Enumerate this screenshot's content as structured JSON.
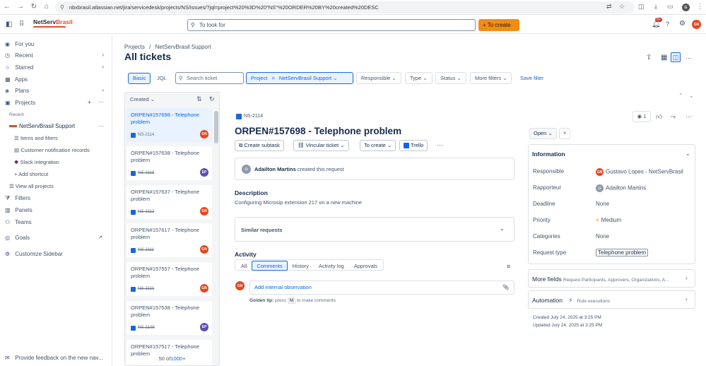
{
  "browser": {
    "url": "nbxbrasil.atlassian.net/jira/servicedesk/projects/NS/issues/?jql=project%20%3D%20\"NS\"%20ORDER%20BY%20created%20DESC",
    "profile_initial": "G"
  },
  "topnav": {
    "logo_a": "NetServ",
    "logo_b": "Brasil",
    "search_placeholder": "To look for",
    "create_label": "To create",
    "notif_badge": "9+",
    "user_initials": "GN"
  },
  "sidebar": {
    "items": [
      {
        "label": "For you",
        "icon": "user-circle-icon"
      },
      {
        "label": "Recent",
        "icon": "clock-icon"
      },
      {
        "label": "Starred",
        "icon": "star-icon"
      },
      {
        "label": "Apps",
        "icon": "apps-icon"
      },
      {
        "label": "Plans",
        "icon": "plans-icon"
      },
      {
        "label": "Projects",
        "icon": "folder-icon"
      }
    ],
    "recent_heading": "Recent",
    "project_name": "NetServBrasil Support",
    "sub_items": [
      "Items and filters",
      "Customer notification records",
      "Slack integration",
      "Add shortcut"
    ],
    "view_all": "View all projects",
    "lower_items": [
      "Filters",
      "Panels",
      "Teams"
    ],
    "goals": "Goals",
    "customize": "Customize Sidebar",
    "feedback": "Provide feedback on the new nav..."
  },
  "main": {
    "breadcrumb_projects": "Projects",
    "breadcrumb_sep": "/",
    "breadcrumb_project": "NetServBrasil Support",
    "title": "All tickets",
    "basic": "Basic",
    "jql": "JQL",
    "search_ticket": "Search ticket",
    "filter_project_label": "Project",
    "filter_project_op": "=",
    "filter_project_value": "NetServBrasil Support",
    "filters": [
      "Responsible",
      "Type",
      "Status",
      "More filters"
    ],
    "save_filter": "Save filter",
    "sort_label": "Created"
  },
  "tickets": [
    {
      "title": "ORPEN#157698 - Telephone problem",
      "key": "NS-2114",
      "av": "GN",
      "avcolor": "#e5481f",
      "selected": true
    },
    {
      "title": "ORPEN#157638 - Telephone problem",
      "key": "NS-2113",
      "av": "EP",
      "avcolor": "#5e4db2",
      "selected": false
    },
    {
      "title": "ORPEN#157637 - Telephone problem",
      "key": "NS-2112",
      "av": "GN",
      "avcolor": "#e5481f",
      "selected": false
    },
    {
      "title": "ORPEN#157617 - Telephone problem",
      "key": "NS-2111",
      "av": "GN",
      "avcolor": "#e5481f",
      "selected": false
    },
    {
      "title": "ORPEN#157557 - Telephone problem",
      "key": "NS-2110",
      "av": "GN",
      "avcolor": "#e5481f",
      "selected": false
    },
    {
      "title": "ORPEN#157538 - Telephone problem",
      "key": "NS-2109",
      "av": "EP",
      "avcolor": "#5e4db2",
      "selected": false
    },
    {
      "title": "ORPEN#157517 - Telephone problem",
      "key": "",
      "av": "",
      "avcolor": "",
      "selected": false
    }
  ],
  "pagination": {
    "shown": "50 of",
    "total": "1000+"
  },
  "detail": {
    "key": "NS-2114",
    "title": "ORPEN#157698 - Telephone problem",
    "actions": [
      "Create subtask",
      "Vincular ticket",
      "To create",
      "Trello"
    ],
    "requester_name": "Adailton Martins",
    "requester_text": "created this request",
    "description_heading": "Description",
    "description": "Configuring Microsip extension 217 on a new machine",
    "similar": "Similar requests",
    "activity_heading": "Activity",
    "activity_tabs": [
      "All",
      "Comments",
      "History",
      "Activity log",
      "Approvals"
    ],
    "activity_selected": "Comments",
    "comment_placeholder": "Add internal observation",
    "tip_bold": "Golden tip:",
    "tip_a": "press",
    "tip_key": "M",
    "tip_b": "to make comments",
    "watchers": "1",
    "status": "Open",
    "info_heading": "Information",
    "fields": [
      {
        "label": "Responsible",
        "value": "Gustavo Lopes - NetServBrasil"
      },
      {
        "label": "Rapporteur",
        "value": "Adailton Martins"
      },
      {
        "label": "Deadline",
        "value": "None"
      },
      {
        "label": "Priority",
        "value": "Medium"
      },
      {
        "label": "Categories",
        "value": "None"
      },
      {
        "label": "Request type",
        "value": "Telephone problem"
      }
    ],
    "more_fields": "More fields",
    "more_fields_sub": "Request Participants, Approvers, Organizations, A...",
    "automation": "Automation",
    "rule_executions": "Rule executions",
    "created": "Created July 24, 2025 at 3:25 PM",
    "updated": "Updated July 24, 2025 at 3:25 PM"
  },
  "colors": {
    "accent": "#1868db",
    "create": "#f18d13",
    "avatar_gn": "#e5481f",
    "avatar_ep": "#5e4db2"
  }
}
